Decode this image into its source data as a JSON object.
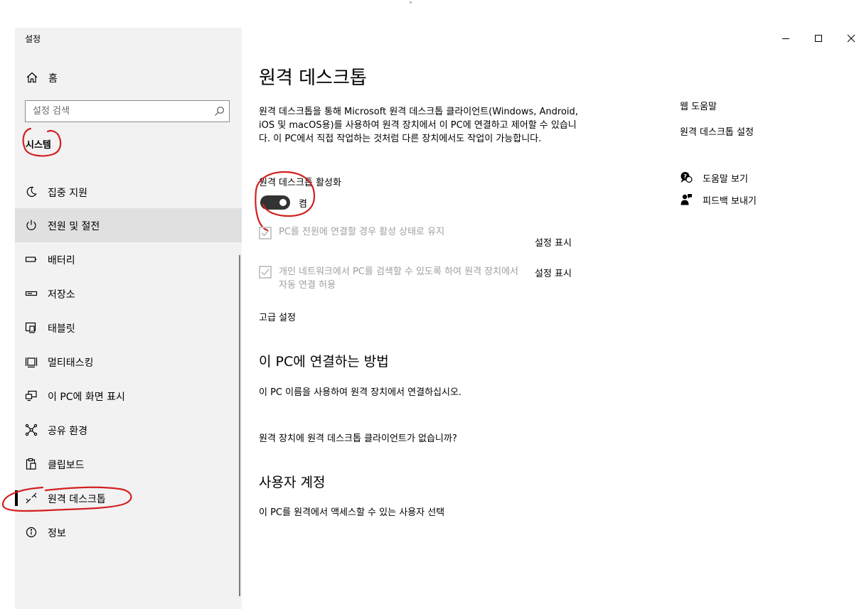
{
  "app": {
    "title": "설정"
  },
  "sidebar": {
    "home_label": "홈",
    "search": {
      "placeholder": "설정 검색"
    },
    "group_title": "시스템",
    "items": [
      {
        "label": "집중 지원",
        "icon": "moon-icon"
      },
      {
        "label": "전원 및 절전",
        "icon": "power-icon"
      },
      {
        "label": "배터리",
        "icon": "battery-icon"
      },
      {
        "label": "저장소",
        "icon": "storage-icon"
      },
      {
        "label": "태블릿",
        "icon": "tablet-icon"
      },
      {
        "label": "멀티태스킹",
        "icon": "multitasking-icon"
      },
      {
        "label": "이 PC에 화면 표시",
        "icon": "project-icon"
      },
      {
        "label": "공유 환경",
        "icon": "share-icon"
      },
      {
        "label": "클립보드",
        "icon": "clipboard-icon"
      },
      {
        "label": "원격 데스크톱",
        "icon": "remote-desktop-icon"
      },
      {
        "label": "정보",
        "icon": "info-icon"
      }
    ]
  },
  "main": {
    "title": "원격 데스크톱",
    "description": "원격 데스크톱을 통해 Microsoft 원격 데스크톱 클라이언트(Windows, Android, iOS 및 macOS용)를 사용하여 원격 장치에서 이 PC에 연결하고 제어할 수 있습니다. 이 PC에서 직접 작업하는 것처럼 다른 장치에서도 작업이 가능합니다.",
    "toggle": {
      "label": "원격 데스크톱 활성화",
      "state": "켬",
      "on": true
    },
    "options": [
      {
        "text": "PC를 전원에 연결할 경우 활성 상태로 유지",
        "link": "설정 표시",
        "checked": true
      },
      {
        "text": "개인 네트워크에서 PC를 검색할 수 있도록 하여 원격 장치에서 자동 연결 허용",
        "link": "설정 표시",
        "checked": true
      }
    ],
    "advanced_link": "고급 설정",
    "connect_heading": "이 PC에 연결하는 방법",
    "connect_text": "이 PC 이름을 사용하여 원격 장치에서 연결하십시오.",
    "no_client_link": "원격 장치에 원격 데스크톱 클라이언트가 없습니까?",
    "accounts_heading": "사용자 계정",
    "accounts_link": "이 PC를 원격에서 액세스할 수 있는 사용자 선택"
  },
  "right_panel": {
    "title": "웹 도움말",
    "link": "원격 데스크톱 설정",
    "items": [
      {
        "label": "도움말 보기",
        "icon": "help-icon"
      },
      {
        "label": "피드백 보내기",
        "icon": "feedback-icon"
      }
    ]
  },
  "colors": {
    "annotation": "#d32020",
    "toggle_on": "#333333",
    "sidebar_bg": "#f2f2f2",
    "hover_bg": "#e0e0e0"
  }
}
